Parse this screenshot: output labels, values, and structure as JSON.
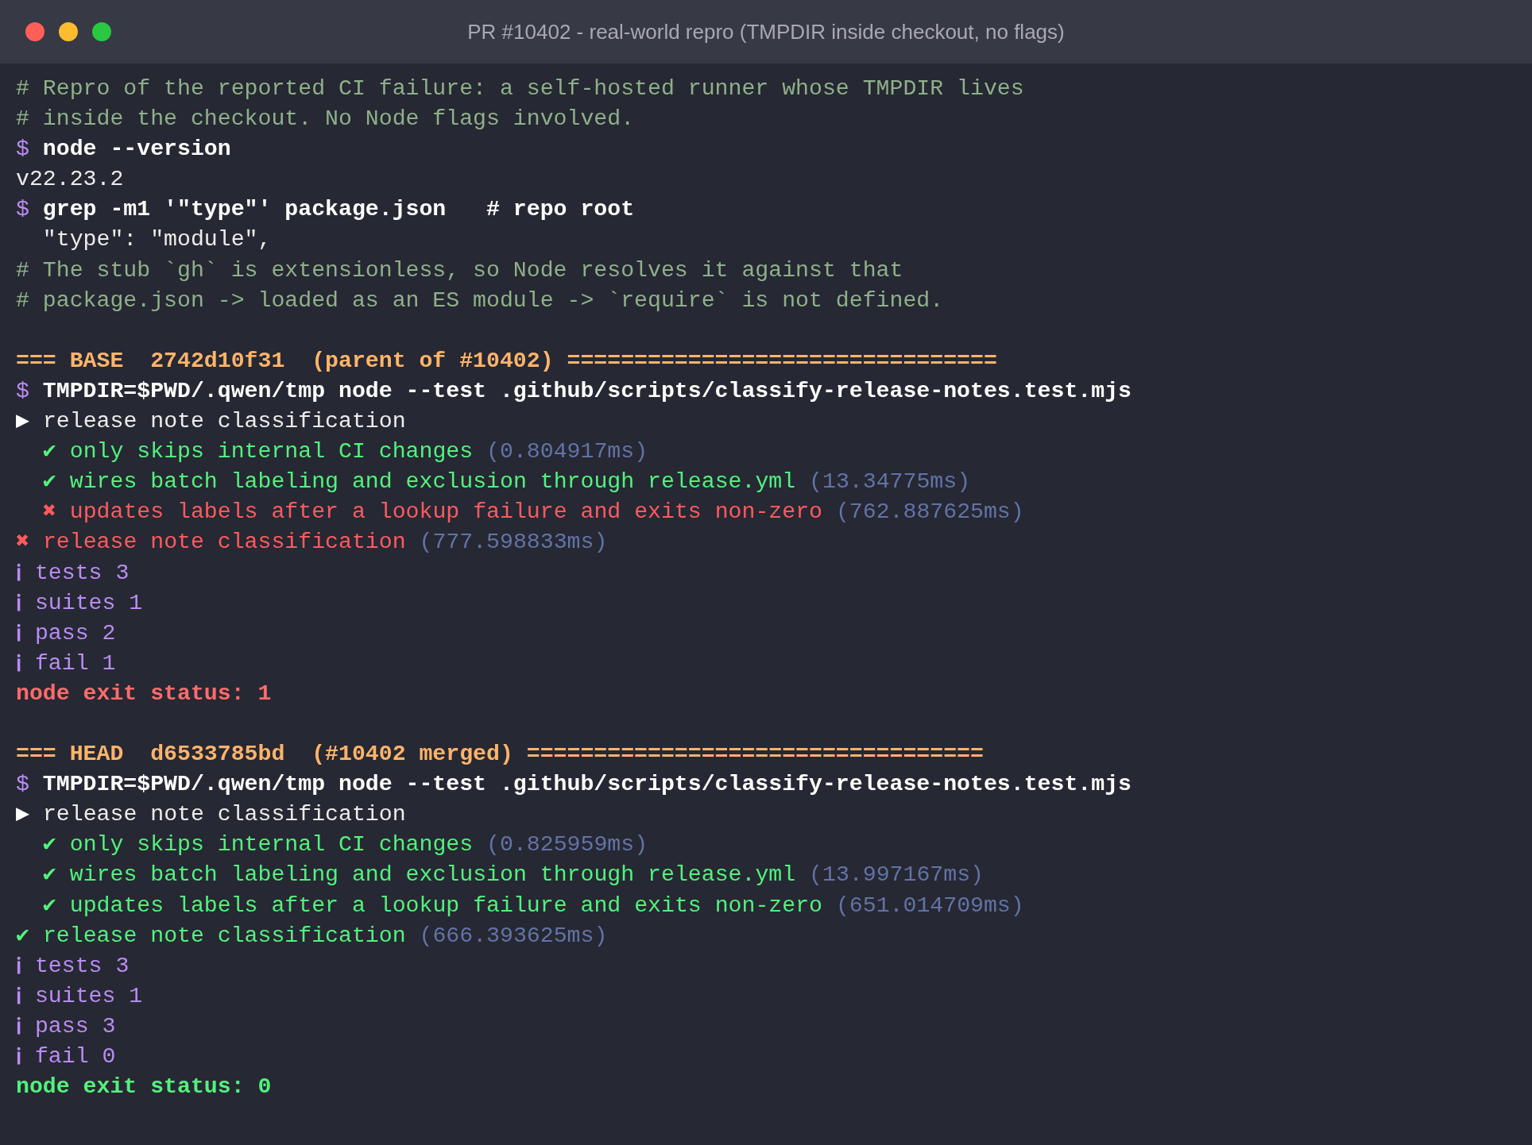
{
  "window": {
    "title": "PR #10402 - real-world repro (TMPDIR inside checkout, no flags)"
  },
  "blocks": [
    {
      "lines": [
        {
          "segments": [
            {
              "kind": "comment",
              "text": "# Repro of the reported CI failure: a self-hosted runner whose TMPDIR lives"
            }
          ]
        },
        {
          "segments": [
            {
              "kind": "comment",
              "text": "# inside the checkout. No Node flags involved."
            }
          ]
        },
        {
          "segments": [
            {
              "kind": "prompt",
              "text": "$"
            },
            {
              "kind": "command",
              "text": "node --version"
            }
          ]
        },
        {
          "segments": [
            {
              "kind": "output",
              "text": "v22.23.2"
            }
          ]
        },
        {
          "segments": [
            {
              "kind": "prompt",
              "text": "$"
            },
            {
              "kind": "command",
              "text": "grep -m1 '\"type\"' package.json   # repo root"
            }
          ]
        },
        {
          "indented": true,
          "segments": [
            {
              "kind": "output",
              "text": "\"type\": \"module\","
            }
          ]
        },
        {
          "segments": [
            {
              "kind": "comment",
              "text": "# The stub `gh` is extensionless, so Node resolves it against that"
            }
          ]
        },
        {
          "segments": [
            {
              "kind": "comment",
              "text": "# package.json -> loaded as an ES module -> `require` is not defined."
            }
          ]
        }
      ]
    },
    {
      "lines": [
        {
          "segments": [
            {
              "kind": "header",
              "text": "=== BASE  2742d10f31  (parent of #10402) ================================"
            }
          ]
        },
        {
          "segments": [
            {
              "kind": "prompt",
              "text": "$"
            },
            {
              "kind": "command",
              "text": "TMPDIR=$PWD/.qwen/tmp node --test .github/scripts/classify-release-notes.test.mjs"
            }
          ]
        },
        {
          "segments": [
            {
              "kind": "arrow_mark",
              "text": "▶"
            },
            {
              "kind": "output",
              "text": "release note classification"
            }
          ]
        },
        {
          "indented": true,
          "segments": [
            {
              "kind": "pass_mark",
              "text": "✔"
            },
            {
              "kind": "pass",
              "text": "only skips internal CI changes"
            },
            {
              "kind": "duration",
              "text": "(0.804917ms)"
            }
          ]
        },
        {
          "indented": true,
          "segments": [
            {
              "kind": "pass_mark",
              "text": "✔"
            },
            {
              "kind": "pass",
              "text": "wires batch labeling and exclusion through release.yml"
            },
            {
              "kind": "duration",
              "text": "(13.34775ms)"
            }
          ]
        },
        {
          "indented": true,
          "segments": [
            {
              "kind": "fail_mark",
              "text": "✖"
            },
            {
              "kind": "fail",
              "text": "updates labels after a lookup failure and exits non-zero"
            },
            {
              "kind": "duration",
              "text": "(762.887625ms)"
            }
          ]
        },
        {
          "segments": [
            {
              "kind": "fail_mark",
              "text": "✖"
            },
            {
              "kind": "fail",
              "text": "release note classification"
            },
            {
              "kind": "duration",
              "text": "(777.598833ms)"
            }
          ]
        },
        {
          "segments": [
            {
              "kind": "info_mark",
              "text": "ℹ"
            },
            {
              "kind": "info",
              "text": "tests 3"
            }
          ]
        },
        {
          "segments": [
            {
              "kind": "info_mark",
              "text": "ℹ"
            },
            {
              "kind": "info",
              "text": "suites 1"
            }
          ]
        },
        {
          "segments": [
            {
              "kind": "info_mark",
              "text": "ℹ"
            },
            {
              "kind": "info",
              "text": "pass 2"
            }
          ]
        },
        {
          "segments": [
            {
              "kind": "info_mark",
              "text": "ℹ"
            },
            {
              "kind": "info",
              "text": "fail 1"
            }
          ]
        },
        {
          "segments": [
            {
              "kind": "exit_fail",
              "text": "node exit status: 1"
            }
          ]
        }
      ]
    },
    {
      "lines": [
        {
          "segments": [
            {
              "kind": "header",
              "text": "=== HEAD  d6533785bd  (#10402 merged) =================================="
            }
          ]
        },
        {
          "segments": [
            {
              "kind": "prompt",
              "text": "$"
            },
            {
              "kind": "command",
              "text": "TMPDIR=$PWD/.qwen/tmp node --test .github/scripts/classify-release-notes.test.mjs"
            }
          ]
        },
        {
          "segments": [
            {
              "kind": "arrow_mark",
              "text": "▶"
            },
            {
              "kind": "output",
              "text": "release note classification"
            }
          ]
        },
        {
          "indented": true,
          "segments": [
            {
              "kind": "pass_mark",
              "text": "✔"
            },
            {
              "kind": "pass",
              "text": "only skips internal CI changes"
            },
            {
              "kind": "duration",
              "text": "(0.825959ms)"
            }
          ]
        },
        {
          "indented": true,
          "segments": [
            {
              "kind": "pass_mark",
              "text": "✔"
            },
            {
              "kind": "pass",
              "text": "wires batch labeling and exclusion through release.yml"
            },
            {
              "kind": "duration",
              "text": "(13.997167ms)"
            }
          ]
        },
        {
          "indented": true,
          "segments": [
            {
              "kind": "pass_mark",
              "text": "✔"
            },
            {
              "kind": "pass",
              "text": "updates labels after a lookup failure and exits non-zero"
            },
            {
              "kind": "duration",
              "text": "(651.014709ms)"
            }
          ]
        },
        {
          "segments": [
            {
              "kind": "pass_mark",
              "text": "✔"
            },
            {
              "kind": "pass",
              "text": "release note classification"
            },
            {
              "kind": "duration",
              "text": "(666.393625ms)"
            }
          ]
        },
        {
          "segments": [
            {
              "kind": "info_mark",
              "text": "ℹ"
            },
            {
              "kind": "info",
              "text": "tests 3"
            }
          ]
        },
        {
          "segments": [
            {
              "kind": "info_mark",
              "text": "ℹ"
            },
            {
              "kind": "info",
              "text": "suites 1"
            }
          ]
        },
        {
          "segments": [
            {
              "kind": "info_mark",
              "text": "ℹ"
            },
            {
              "kind": "info",
              "text": "pass 3"
            }
          ]
        },
        {
          "segments": [
            {
              "kind": "info_mark",
              "text": "ℹ"
            },
            {
              "kind": "info",
              "text": "fail 0"
            }
          ]
        },
        {
          "segments": [
            {
              "kind": "exit_ok",
              "text": "node exit status: 0"
            }
          ]
        }
      ]
    }
  ]
}
